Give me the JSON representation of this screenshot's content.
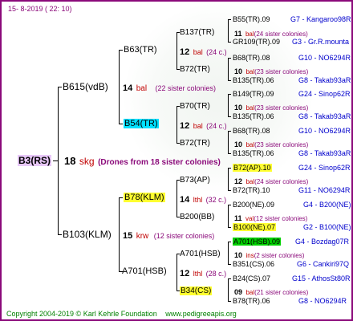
{
  "date": "15-  8-2019 (  22:  10)",
  "footer": {
    "copyright": "Copyright 2004-2019 © Karl Kehrle Foundation",
    "site": "www.pedigreeapis.org"
  },
  "root": {
    "label": "B3(RS)",
    "count": "18",
    "code": "skg",
    "drones": "(Drones from 18 sister colonies)"
  },
  "gen2": [
    {
      "label": "B615(vdB)",
      "count": "14",
      "code": "bal",
      "sisters": "(22 sister colonies)"
    },
    {
      "label": "B103(KLM)",
      "count": "15",
      "code": "krw",
      "sisters": "(12 sister colonies)"
    }
  ],
  "gen3": [
    {
      "label": "B63(TR)",
      "count": "12",
      "code": "bal",
      "sisters": "(24 c.)"
    },
    {
      "label": "B54(TR)",
      "count": "12",
      "code": "bal",
      "sisters": "(24 c.)"
    },
    {
      "label": "B78(KLM)",
      "count": "14",
      "code": "lthl",
      "sisters": "(32 c.)"
    },
    {
      "label": "A701(HSB)",
      "count": "12",
      "code": "lthl",
      "sisters": "(28 c.)"
    }
  ],
  "gen4": [
    {
      "label": "B137(TR)",
      "count": "11",
      "code": "bal",
      "sisters": "(24 sister colonies)"
    },
    {
      "label": "B72(TR)",
      "count": "10",
      "code": "bal",
      "sisters": "(23 sister colonies)"
    },
    {
      "label": "B70(TR)",
      "count": "10",
      "code": "bal",
      "sisters": "(23 sister colonies)"
    },
    {
      "label": "B72(TR)",
      "count": "10",
      "code": "bal",
      "sisters": "(23 sister colonies)"
    },
    {
      "label": "B73(AP)",
      "count": "12",
      "code": "bal",
      "sisters": "(24 sister colonies)"
    },
    {
      "label": "B200(BB)",
      "count": "11",
      "code": "val",
      "sisters": "(12 sister colonies)"
    },
    {
      "label": "A701(HSB)",
      "count": "10",
      "code": "ins",
      "sisters": "(2 sister colonies)"
    },
    {
      "label": "B34(CS)",
      "count": "09",
      "code": "bal",
      "sisters": "(21 sister colonies)"
    }
  ],
  "gen5": [
    {
      "label": "B55(TR).09",
      "info": "G7 - Kangaroo98R"
    },
    {
      "label": "GR109(TR).09",
      "info": "G3 - Gr.R.mounta"
    },
    {
      "label": "B68(TR).08",
      "info": "G10 - NO6294R"
    },
    {
      "label": "B135(TR).06",
      "info": "G8 - Takab93aR"
    },
    {
      "label": "B149(TR).09",
      "info": "G24 - Sinop62R"
    },
    {
      "label": "B135(TR).06",
      "info": "G8 - Takab93aR"
    },
    {
      "label": "B68(TR).08",
      "info": "G10 - NO6294R"
    },
    {
      "label": "B135(TR).06",
      "info": "G8 - Takab93aR"
    },
    {
      "label": "B72(AP).10",
      "info": "G24 - Sinop62R"
    },
    {
      "label": "B72(TR).10",
      "info": "G11 - NO6294R"
    },
    {
      "label": "B200(NE).09",
      "info": "G4 - B200(NE)"
    },
    {
      "label": "B100(NE).07",
      "info": "G2 - B100(NE)"
    },
    {
      "label": "A701(HSB).09",
      "info": "G4 - Bozdag07R"
    },
    {
      "label": "B351(CS).06",
      "info": "G6 - Cankiri97Q"
    },
    {
      "label": "B24(CS).07",
      "info": "G15 - AthosSt80R"
    },
    {
      "label": "B78(TR).06",
      "info": "G8 - NO6294R"
    }
  ],
  "colors": {
    "frame": "#8b0a7a",
    "root_bg": "#e8c8f8",
    "cyan": "#00e0ff",
    "yellow": "#ffff30",
    "green": "#00d000",
    "species": "#c00000",
    "info": "#0000cc",
    "footer": "#008000"
  }
}
